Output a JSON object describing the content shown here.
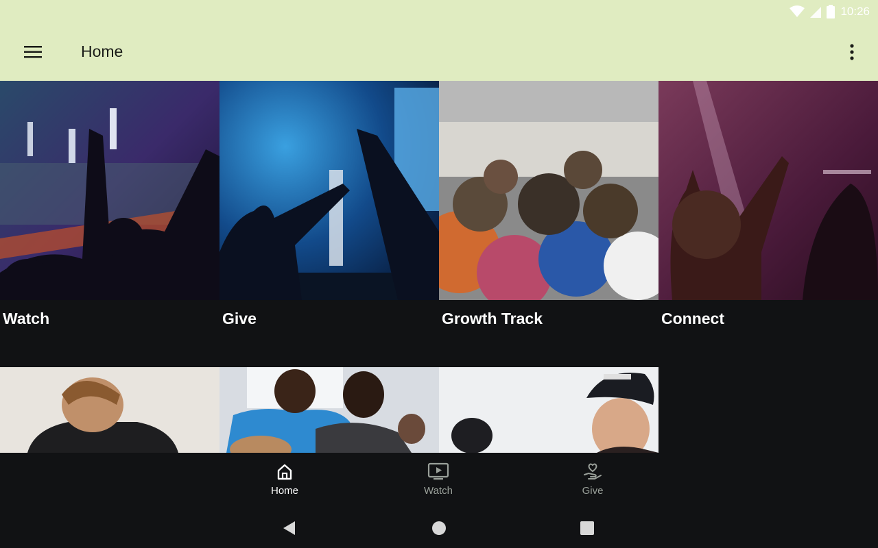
{
  "status_bar": {
    "time": "10:26",
    "icons": [
      "wifi-icon",
      "signal-icon",
      "battery-icon"
    ]
  },
  "app_bar": {
    "title": "Home",
    "menu_icon": "hamburger-menu-icon",
    "more_icon": "more-vertical-icon",
    "background": "#e0ecc1"
  },
  "tiles": [
    {
      "label": "Watch"
    },
    {
      "label": "Give"
    },
    {
      "label": "Growth Track"
    },
    {
      "label": "Connect"
    },
    {
      "label": ""
    },
    {
      "label": ""
    },
    {
      "label": ""
    }
  ],
  "bottom_nav": {
    "items": [
      {
        "label": "Home",
        "icon": "home-icon",
        "active": true
      },
      {
        "label": "Watch",
        "icon": "tv-play-icon",
        "active": false
      },
      {
        "label": "Give",
        "icon": "heart-hand-icon",
        "active": false
      }
    ],
    "active_color": "#ffffff",
    "inactive_color": "#9aa09a"
  },
  "system_nav": {
    "icons": [
      "back-icon",
      "home-circle-icon",
      "recents-icon"
    ]
  }
}
